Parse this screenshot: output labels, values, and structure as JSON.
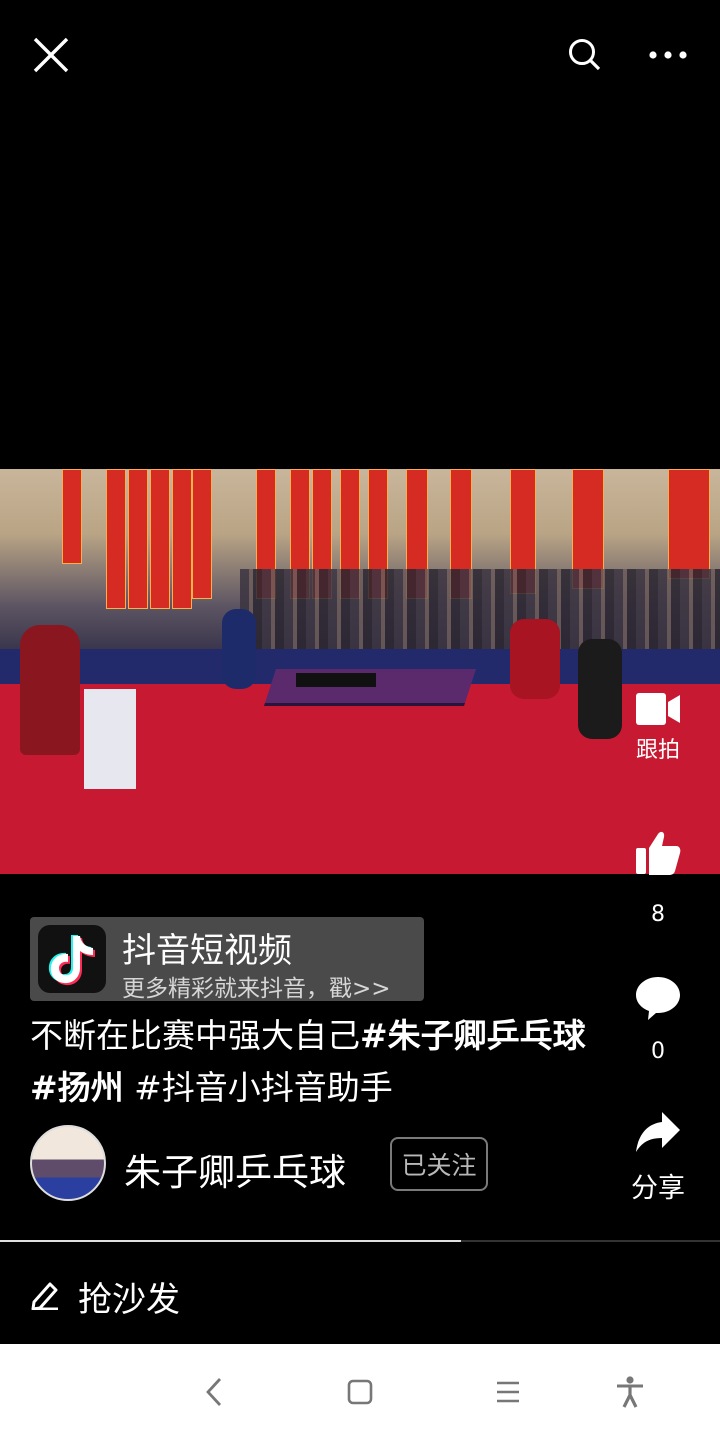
{
  "top_bar": {
    "close_icon": "close-icon",
    "search_icon": "search-icon",
    "more_icon": "more-horizontal-icon"
  },
  "side_actions": {
    "follow_shoot": {
      "icon": "video-camera-icon",
      "label": "跟拍"
    },
    "like": {
      "icon": "thumbs-up-icon",
      "count": "8"
    },
    "comment": {
      "icon": "comment-bubble-icon",
      "count": "0"
    },
    "share": {
      "icon": "share-arrow-icon",
      "label": "分享"
    }
  },
  "promo": {
    "title": "抖音短视频",
    "subtitle": "更多精彩就来抖音，戳>>"
  },
  "caption": {
    "text": "不断在比赛中强大自己",
    "tag1": "#朱子卿乒乓球",
    "tag2": "#扬州",
    "tag3": "#抖音小抖音助手"
  },
  "author": {
    "name": "朱子卿乒乓球",
    "follow_status": "已关注"
  },
  "progress": {
    "played_fraction": 0.64
  },
  "comment_bar": {
    "placeholder": "抢沙发"
  },
  "nav_bar": {
    "back_icon": "back-chevron-icon",
    "home_icon": "home-square-icon",
    "menu_icon": "menu-lines-icon",
    "accessibility_icon": "accessibility-icon"
  },
  "colors": {
    "background": "#000000",
    "nav_background": "#ffffff",
    "promo_background": "#4a4a4a"
  }
}
